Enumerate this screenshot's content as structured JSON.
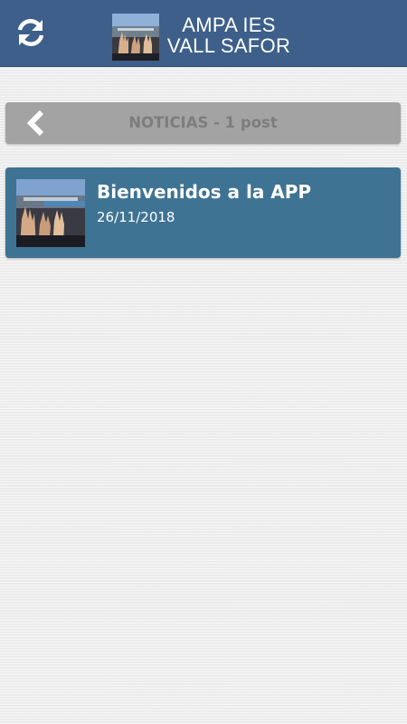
{
  "header": {
    "title_line1": "AMPA IES",
    "title_line2": "VALL SAFOR",
    "refresh_icon": "refresh-icon",
    "logo_icon": "raised-hands-photo"
  },
  "section": {
    "title": "NOTICIAS - 1 post",
    "back_icon": "chevron-left-icon"
  },
  "posts": [
    {
      "title": "Bienvenidos a la APP",
      "date": "26/11/2018",
      "thumbnail": "raised-hands-photo"
    }
  ],
  "colors": {
    "header_bg": "#3d5f8a",
    "section_bar_bg": "#a3a3a3",
    "section_text": "#7d7d7d",
    "post_card_bg": "#3f7393",
    "page_bg": "#ececec"
  }
}
